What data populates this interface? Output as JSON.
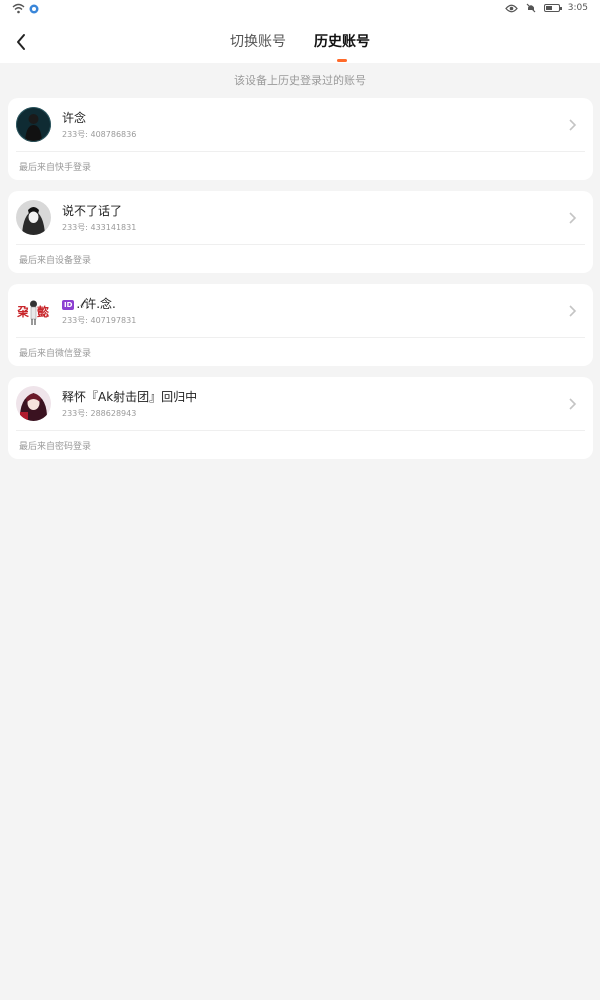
{
  "statusbar": {
    "time": "3:05"
  },
  "header": {
    "tabs": [
      {
        "label": "切换账号",
        "active": false
      },
      {
        "label": "历史账号",
        "active": true
      }
    ]
  },
  "subtitle": "该设备上历史登录过的账号",
  "accounts": [
    {
      "name": "许念",
      "uid": "233号: 408786836",
      "login_source": "最后来自快手登录"
    },
    {
      "name": "说不了话了",
      "uid": "233号: 433141831",
      "login_source": "最后来自设备登录"
    },
    {
      "badge": "ID",
      "name": ".𝓁许.念.",
      "uid": "233号: 407197831",
      "login_source": "最后来自微信登录"
    },
    {
      "name": "释怀『Ak射击团』回归中",
      "uid": "233号: 288628943",
      "login_source": "最后来自密码登录"
    }
  ],
  "colors": {
    "accent": "#ff6a2a",
    "badge": "#8c3fd1"
  }
}
